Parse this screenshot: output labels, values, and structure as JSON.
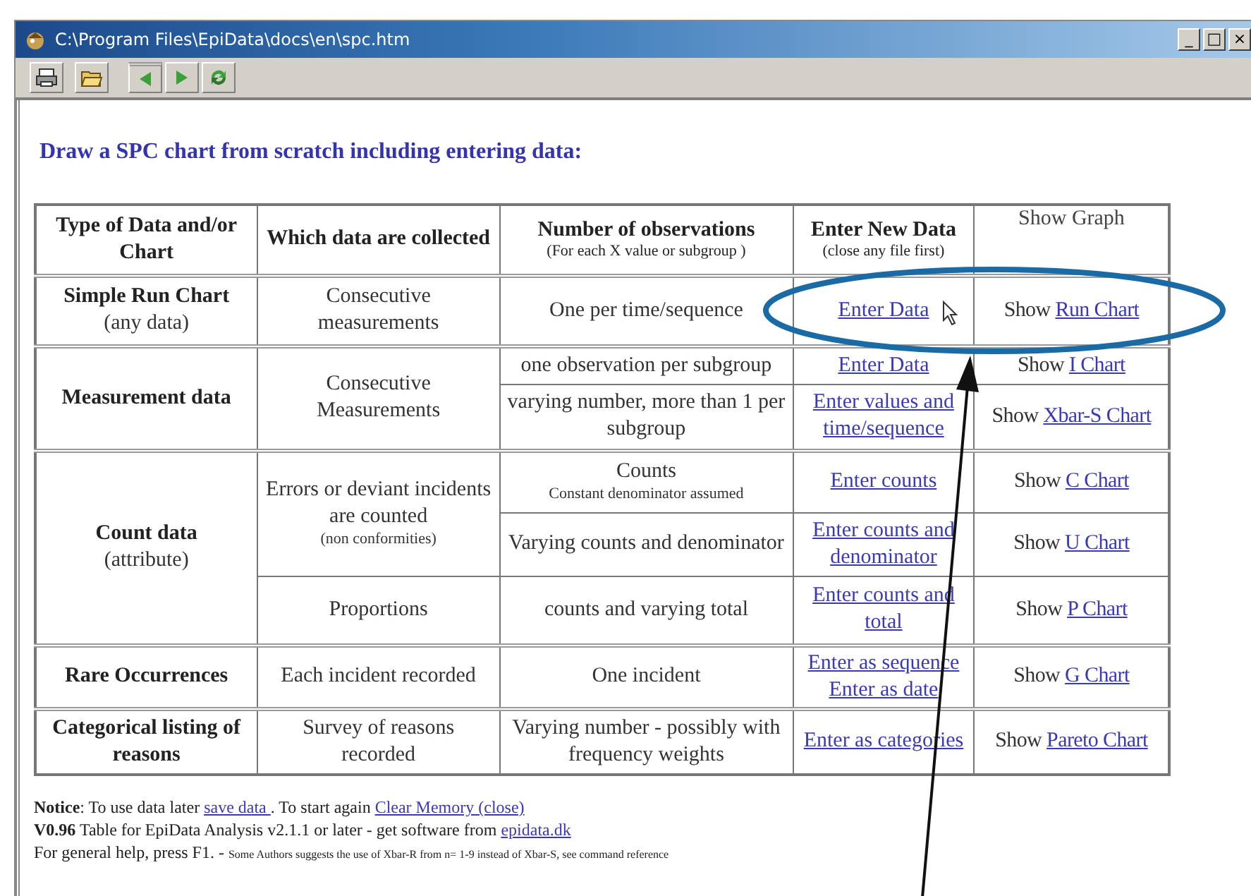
{
  "window": {
    "title": "C:\\Program Files\\EpiData\\docs\\en\\spc.htm",
    "controls": [
      "_",
      "□",
      "×"
    ]
  },
  "toolbar": [
    {
      "kind": "print"
    },
    {
      "kind": "open"
    },
    {
      "kind": "back"
    },
    {
      "kind": "forward"
    },
    {
      "kind": "refresh"
    }
  ],
  "heading": "Draw a SPC chart from scratch including entering data:",
  "table": {
    "columns": [
      {
        "title": "Type of Data and/or Chart",
        "bold": true
      },
      {
        "title": "Which data are collected",
        "bold": true
      },
      {
        "title": "Number of observations",
        "note": "(For each X value or subgroup )",
        "bold": true
      },
      {
        "title": "Enter New Data",
        "note": "(close any file first)",
        "bold": true
      },
      {
        "title": "Show Graph",
        "bold": false
      }
    ],
    "groups": [
      {
        "title": "Simple Run Chart",
        "subtitle": "(any data)",
        "collected": [
          {
            "text": "Consecutive measurements",
            "rows": [
              {
                "observations": "One per time/sequence",
                "enter": [
                  "Enter Data"
                ],
                "cursor": true,
                "show": "Show",
                "chart": "Run Chart"
              }
            ]
          }
        ]
      },
      {
        "title": "Measurement data",
        "collected": [
          {
            "text": "Consecutive Measurements",
            "rows": [
              {
                "observations": "one observation per subgroup",
                "enter": [
                  "Enter Data"
                ],
                "cursor": false,
                "show": "Show",
                "chart": "I Chart"
              },
              {
                "observations": "varying number, more than 1 per subgroup",
                "enter": [
                  "Enter values and time/sequence"
                ],
                "cursor": false,
                "show": "Show",
                "chart": "Xbar-S Chart"
              }
            ]
          }
        ]
      },
      {
        "title": "Count data",
        "subtitle": "(attribute)",
        "collected": [
          {
            "text": "Errors or deviant incidents are counted",
            "note": "(non conformities)",
            "rows": [
              {
                "observations": "Counts",
                "note": "Constant denominator assumed",
                "enter": [
                  "Enter counts"
                ],
                "cursor": false,
                "show": "Show",
                "chart": "C Chart"
              },
              {
                "observations": "Varying counts and denominator",
                "enter": [
                  "Enter counts and denominator"
                ],
                "cursor": false,
                "show": "Show",
                "chart": "U Chart"
              }
            ]
          },
          {
            "text": "Proportions",
            "rows": [
              {
                "observations": "counts and varying total",
                "enter": [
                  "Enter counts and total"
                ],
                "cursor": false,
                "show": "Show",
                "chart": "P Chart"
              }
            ]
          }
        ]
      },
      {
        "title": "Rare Occurrences",
        "collected": [
          {
            "text": "Each incident recorded",
            "rows": [
              {
                "observations": "One incident",
                "enter": [
                  "Enter as sequence",
                  "Enter as date"
                ],
                "cursor": false,
                "show": "Show",
                "chart": "G Chart"
              }
            ]
          }
        ]
      },
      {
        "title": "Categorical listing of reasons",
        "collected": [
          {
            "text": "Survey of reasons recorded",
            "rows": [
              {
                "observations": "Varying number - possibly with frequency weights",
                "enter": [
                  "Enter as categories"
                ],
                "cursor": false,
                "show": "Show",
                "chart": "Pareto Chart"
              }
            ]
          }
        ]
      }
    ]
  },
  "footer": [
    [
      {
        "kind": "bold",
        "text": "Notice"
      },
      {
        "kind": "text",
        "text": ": To use data later "
      },
      {
        "kind": "link",
        "text": "save data "
      },
      {
        "kind": "text",
        "text": ". To start again "
      },
      {
        "kind": "link",
        "text": "Clear Memory (close)"
      }
    ],
    [
      {
        "kind": "bold",
        "text": "V0.96"
      },
      {
        "kind": "text",
        "text": " Table for EpiData Analysis v2.1.1 or later - get software from "
      },
      {
        "kind": "link",
        "text": "epidata.dk"
      }
    ],
    [
      {
        "kind": "text",
        "text": "For general help, press F1. - "
      },
      {
        "kind": "small",
        "text": "Some Authors suggests the use of Xbar-R from n= 1-9 instead of Xbar-S, see command reference"
      }
    ]
  ],
  "annotation": {
    "ellipse": true,
    "arrow": true
  }
}
